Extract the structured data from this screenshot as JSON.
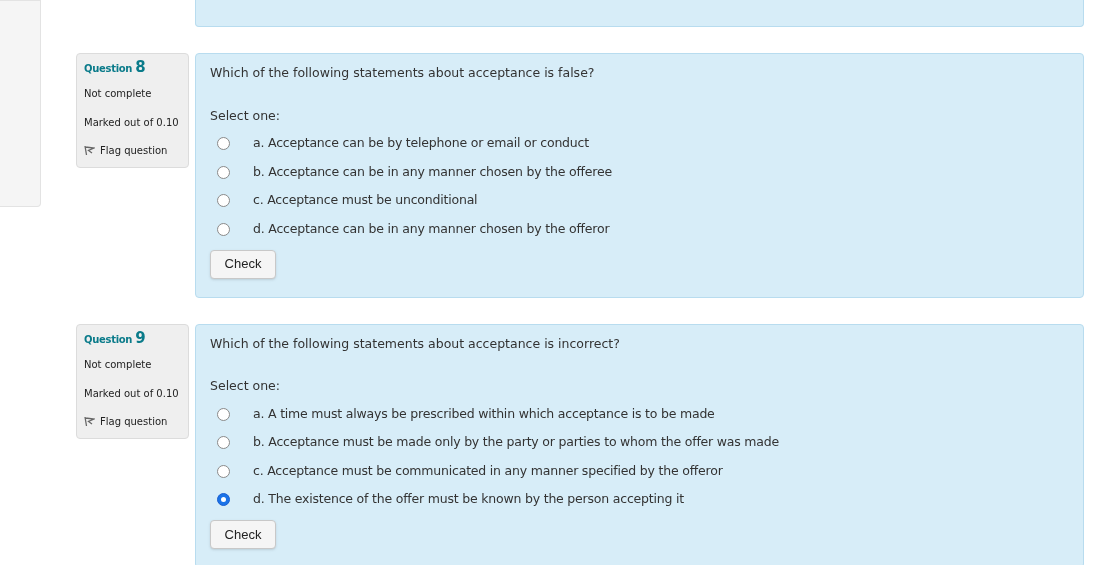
{
  "questions": [
    {
      "label": "Question",
      "number": "8",
      "state": "Not complete",
      "mark": "Marked out of 0.10",
      "flag": "Flag question",
      "text": "Which of the following statements about acceptance is false?",
      "prompt": "Select one:",
      "options": [
        {
          "letter": "a.",
          "text": "Acceptance can be by telephone or email or conduct",
          "selected": false
        },
        {
          "letter": "b.",
          "text": "Acceptance can be in any manner chosen by the offeree",
          "selected": false
        },
        {
          "letter": "c.",
          "text": "Acceptance must be unconditional",
          "selected": false
        },
        {
          "letter": "d.",
          "text": "Acceptance can be in any manner chosen by the offeror",
          "selected": false
        }
      ],
      "button": "Check"
    },
    {
      "label": "Question",
      "number": "9",
      "state": "Not complete",
      "mark": "Marked out of 0.10",
      "flag": "Flag question",
      "text": "Which of the following statements about acceptance is incorrect?",
      "prompt": "Select one:",
      "options": [
        {
          "letter": "a.",
          "text": "A time must always be prescribed within which acceptance is to be made",
          "selected": false
        },
        {
          "letter": "b.",
          "text": "Acceptance must be made only by the party or parties to whom the offer was made",
          "selected": false
        },
        {
          "letter": "c.",
          "text": "Acceptance must be communicated in any manner specified by the offeror",
          "selected": false
        },
        {
          "letter": "d.",
          "text": "The existence of the offer must be known by the person accepting it",
          "selected": true
        }
      ],
      "button": "Check"
    }
  ]
}
